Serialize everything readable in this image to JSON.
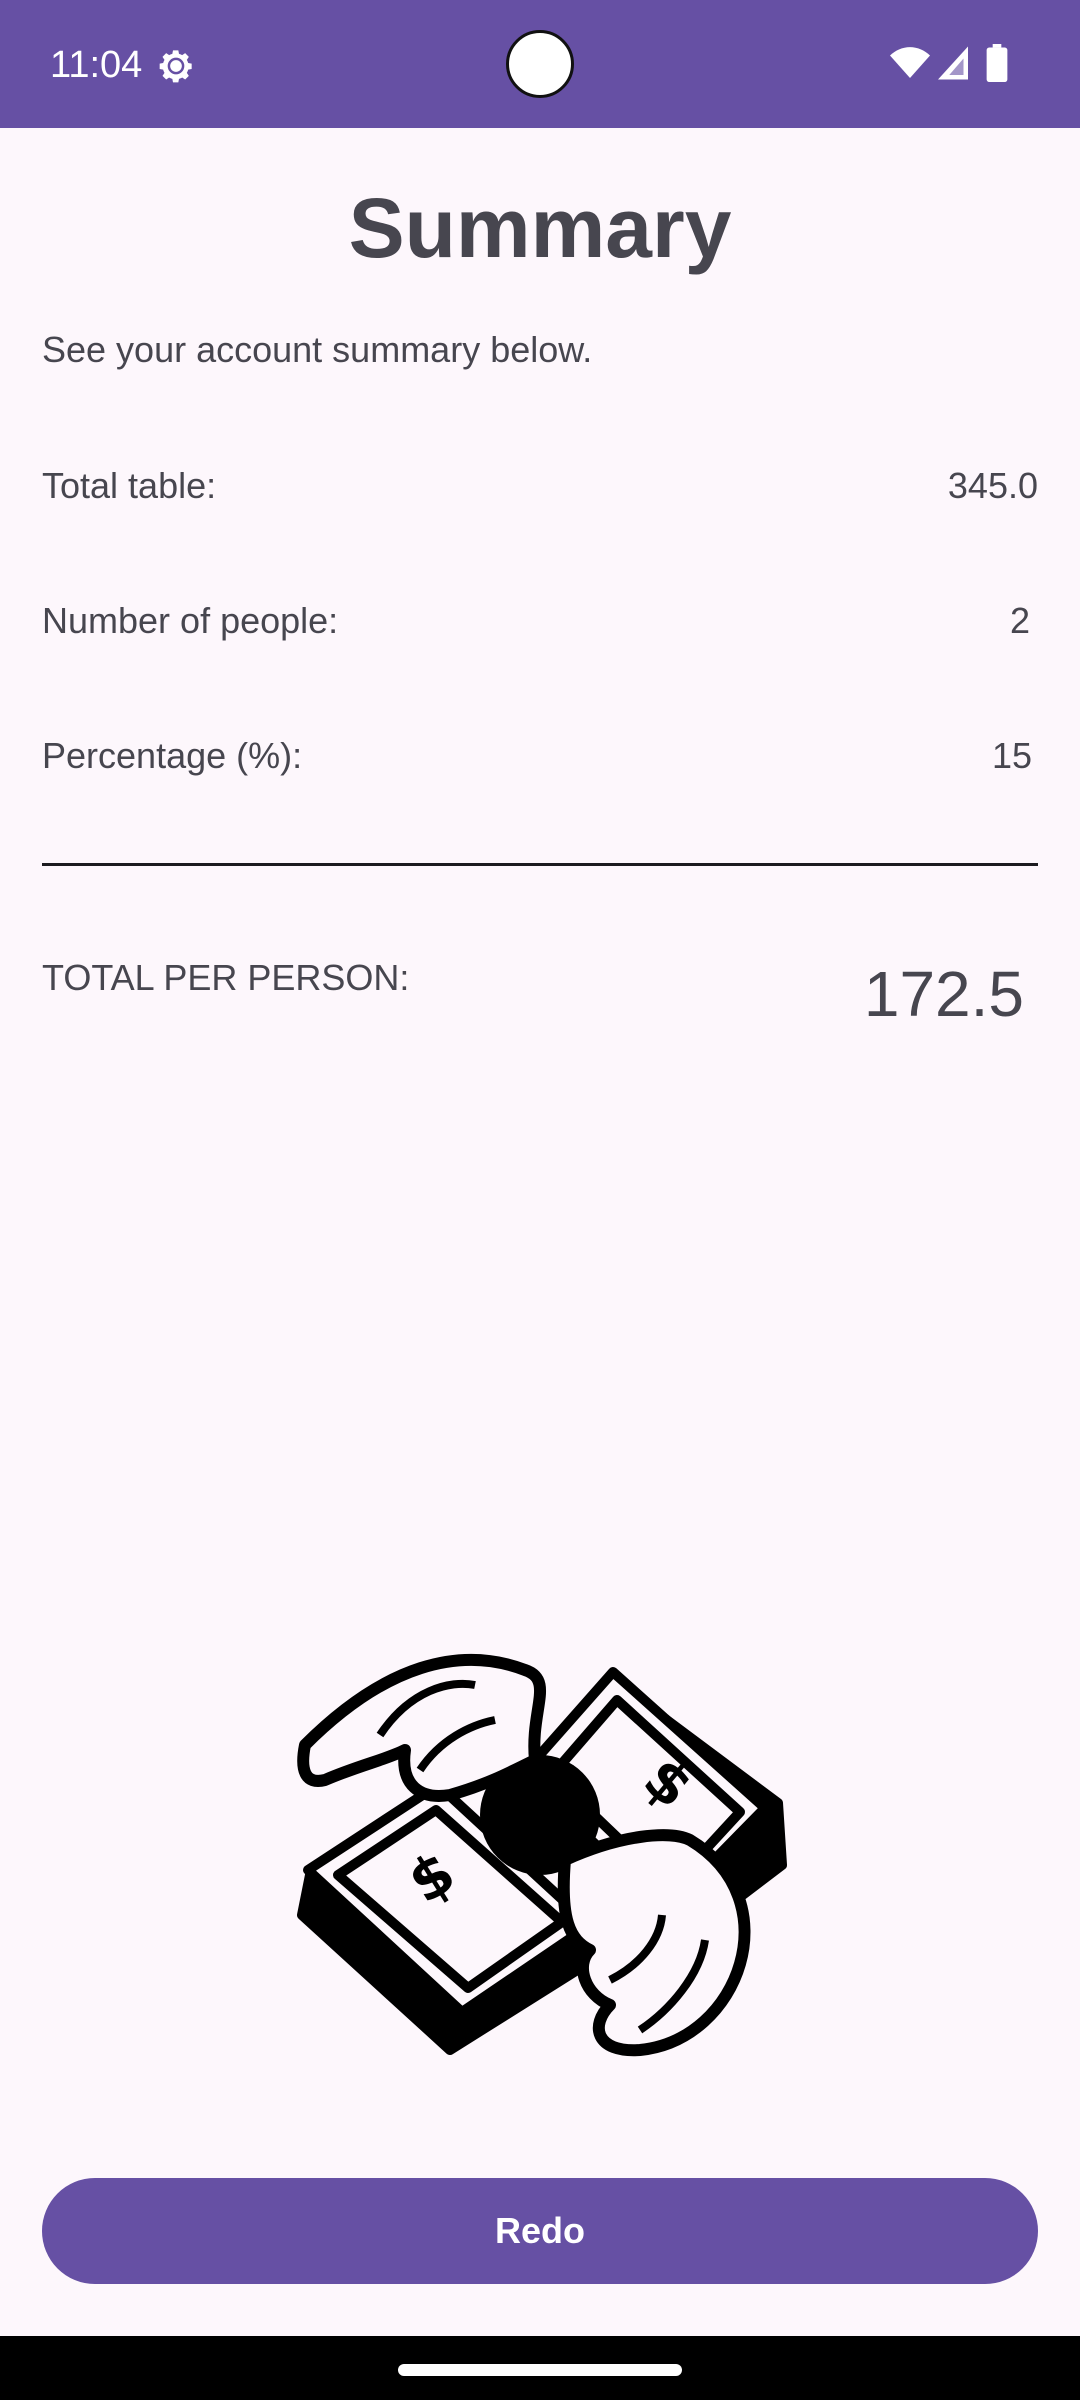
{
  "status_bar": {
    "time": "11:04",
    "icons": [
      "gear-icon",
      "camera-cutout",
      "wifi-icon",
      "signal-icon",
      "battery-icon"
    ]
  },
  "summary": {
    "title": "Summary",
    "intro": "See your account summary below.",
    "rows": [
      {
        "label": "Total table:",
        "value": "345.0"
      },
      {
        "label": "Number of people:",
        "value": "2"
      },
      {
        "label": "Percentage (%):",
        "value": "15"
      }
    ],
    "total_label": "TOTAL PER PERSON:",
    "total_value": "172.5"
  },
  "illustration": {
    "icon": "flying-money-icon"
  },
  "actions": {
    "redo_label": "Redo"
  },
  "colors": {
    "primary": "#6650a4",
    "background": "#fdf7fc",
    "text": "#47464f"
  }
}
